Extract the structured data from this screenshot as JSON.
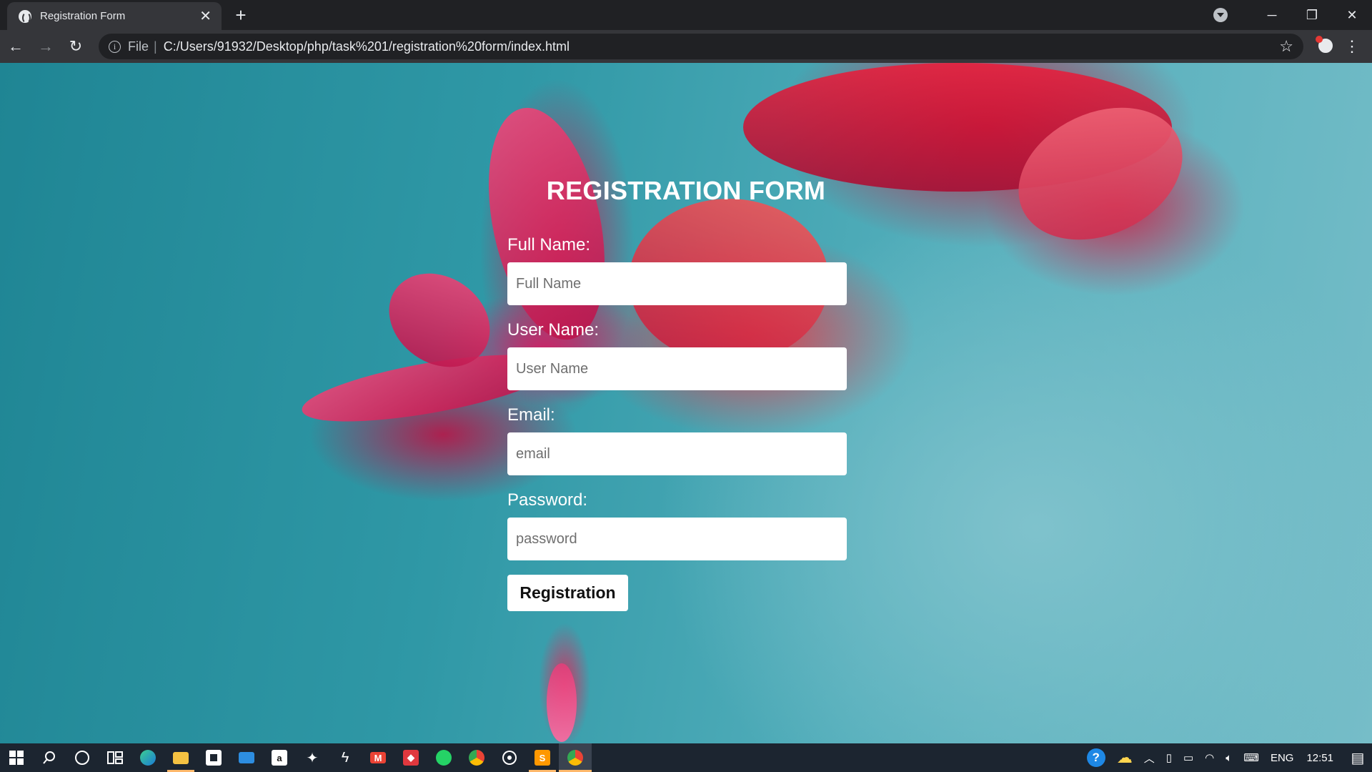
{
  "browser": {
    "tab_title": "Registration Form",
    "tab_close": "✕",
    "new_tab": "+",
    "scheme_label": "File",
    "url": "C:/Users/91932/Desktop/php/task%201/registration%20form/index.html"
  },
  "form": {
    "title": "REGISTRATION FORM",
    "fields": [
      {
        "label": "Full Name:",
        "placeholder": "Full Name",
        "value": ""
      },
      {
        "label": "User Name:",
        "placeholder": "User Name",
        "value": ""
      },
      {
        "label": "Email:",
        "placeholder": "email",
        "value": ""
      },
      {
        "label": "Password:",
        "placeholder": "password",
        "value": ""
      }
    ],
    "submit_label": "Registration"
  },
  "taskbar": {
    "language": "ENG",
    "time": "12:51"
  },
  "colors": {
    "accent_taskbar": "#ffb86b",
    "page_background": "teal with red flower"
  }
}
